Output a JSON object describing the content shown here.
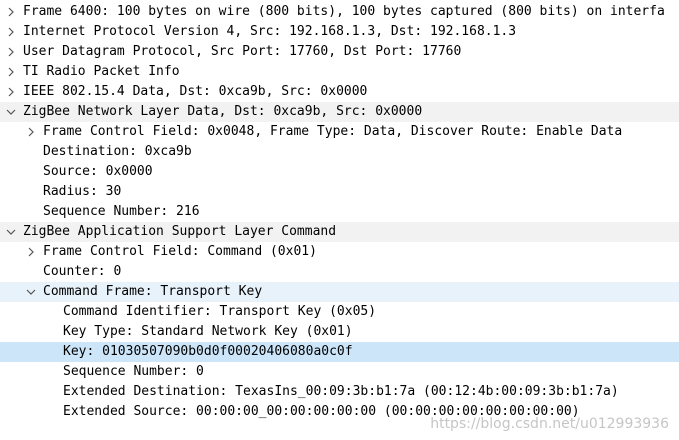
{
  "tree": {
    "frame": "Frame 6400: 100 bytes on wire (800 bits), 100 bytes captured (800 bits) on interfa",
    "ip": "Internet Protocol Version 4, Src: 192.168.1.3, Dst: 192.168.1.3",
    "udp": "User Datagram Protocol, Src Port: 17760, Dst Port: 17760",
    "ti_radio": "TI Radio Packet Info",
    "ieee": "IEEE 802.15.4 Data, Dst: 0xca9b, Src: 0x0000",
    "nwk": {
      "title": "ZigBee Network Layer Data, Dst: 0xca9b, Src: 0x0000",
      "fcf": "Frame Control Field: 0x0048, Frame Type: Data, Discover Route: Enable Data",
      "destination": "Destination: 0xca9b",
      "source": "Source: 0x0000",
      "radius": "Radius: 30",
      "seq": "Sequence Number: 216"
    },
    "aps": {
      "title": "ZigBee Application Support Layer Command",
      "fcf": "Frame Control Field: Command (0x01)",
      "counter": "Counter: 0",
      "cmd": {
        "title": "Command Frame: Transport Key",
        "identifier": "Command Identifier: Transport Key (0x05)",
        "key_type": "Key Type: Standard Network Key (0x01)",
        "key": "Key: 01030507090b0d0f00020406080a0c0f",
        "seq": "Sequence Number: 0",
        "ext_dest": "Extended Destination: TexasIns_00:09:3b:b1:7a (00:12:4b:00:09:3b:b1:7a)",
        "ext_src": "Extended Source: 00:00:00_00:00:00:00:00 (00:00:00:00:00:00:00:00)"
      }
    }
  },
  "watermark": "https://blog.csdn.net/u012993936",
  "colors": {
    "expanded_header_bg": "#f2f2f2",
    "parent_highlight_bg": "#e8f2fb",
    "selected_bg": "#cce5f9"
  }
}
